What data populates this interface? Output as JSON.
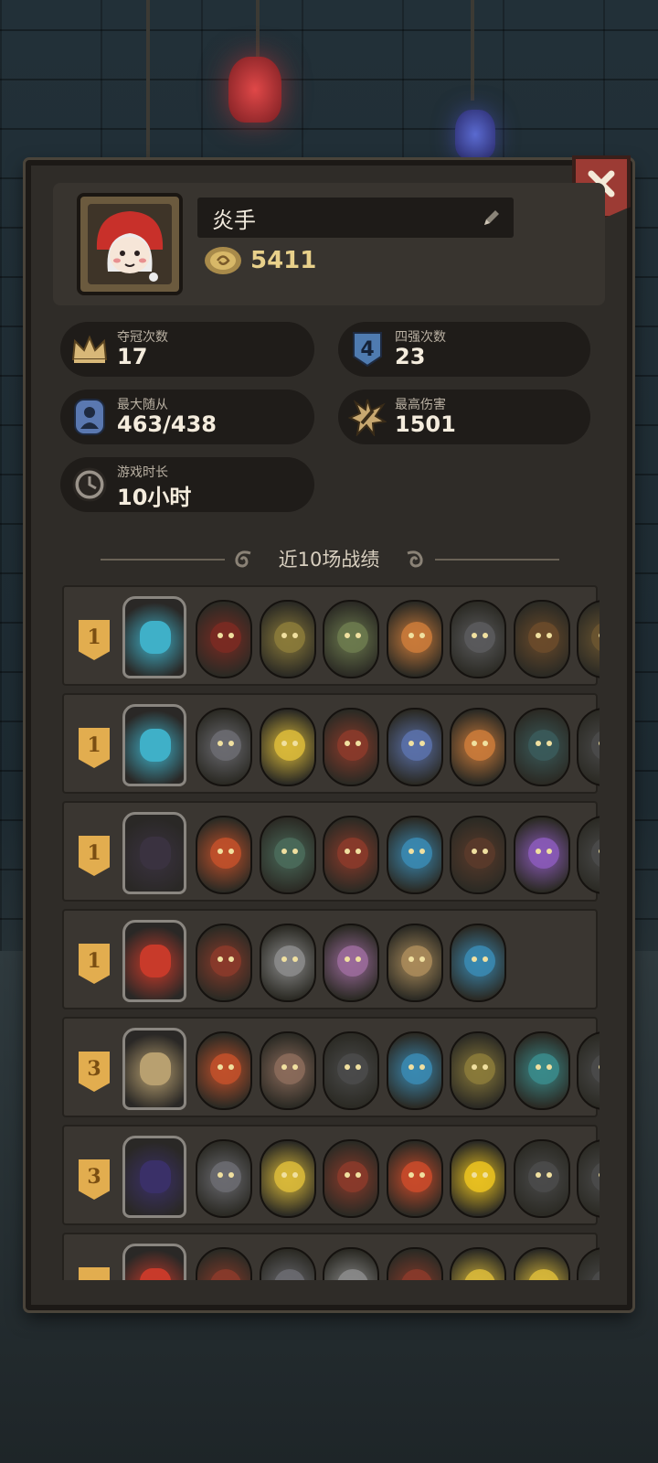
{
  "player": {
    "name": "炎手",
    "coins": "5411"
  },
  "stats": [
    {
      "label": "夺冠次数",
      "value": "17",
      "icon": "crown-icon"
    },
    {
      "label": "四强次数",
      "value": "23",
      "icon": "top4-shield-icon"
    },
    {
      "label": "最大随从",
      "value": "463/438",
      "icon": "minion-icon"
    },
    {
      "label": "最高伤害",
      "value": "1501",
      "icon": "damage-burst-icon"
    },
    {
      "label": "游戏时长",
      "value": "10小时",
      "icon": "clock-icon"
    }
  ],
  "section": {
    "title": "近10场战绩"
  },
  "matches": [
    {
      "rank": "1",
      "hero_color": "#3fb0c8",
      "units": [
        "#7a2a22",
        "#8a7a3a",
        "#6c7a4e",
        "#c97a3a",
        "#5a5a5c",
        "#6a4a2a",
        "#6a5430"
      ]
    },
    {
      "rank": "1",
      "hero_color": "#3fb0c8",
      "units": [
        "#6a6a70",
        "#d8b83a",
        "#8a3a2a",
        "#5a70a8",
        "#c97a3a",
        "#3a5a5a",
        "#4a4a4a"
      ]
    },
    {
      "rank": "1",
      "hero_color": "#3a3240",
      "units": [
        "#c0502a",
        "#4a6a5a",
        "#8a3a2a",
        "#3a88b0",
        "#5a3a2a",
        "#8a5ab8",
        "#4a4a4a"
      ]
    },
    {
      "rank": "1",
      "hero_color": "#c83a2a",
      "units": [
        "#8a3a2a",
        "#8a8a8a",
        "#9a6a9a",
        "#a88a5a",
        "#3a88b0",
        "",
        ""
      ]
    },
    {
      "rank": "3",
      "hero_color": "#b8a070",
      "units": [
        "#c0502a",
        "#8a6a5a",
        "#4a4a4a",
        "#3a88b0",
        "#8a7a3a",
        "#3a8a8a",
        "#4a4a4a"
      ]
    },
    {
      "rank": "3",
      "hero_color": "#3a3068",
      "units": [
        "#6a6a70",
        "#d8b83a",
        "#8a3a2a",
        "#c84a2a",
        "#e8c020",
        "#4a4a4a",
        "#4a4a4a"
      ]
    },
    {
      "rank": "",
      "hero_color": "#c83a2a",
      "units": [
        "#8a3a2a",
        "#6a6a70",
        "#8a8a8a",
        "#8a3a2a",
        "#d8b83a",
        "#d8b83a",
        "#4a4a4a"
      ]
    }
  ]
}
